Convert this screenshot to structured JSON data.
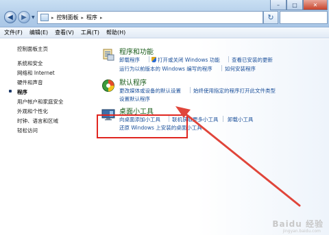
{
  "address": {
    "segments": [
      "控制面板",
      "程序"
    ],
    "separator": "▸"
  },
  "menu": [
    "文件(F)",
    "编辑(E)",
    "查看(V)",
    "工具(T)",
    "帮助(H)"
  ],
  "sidebar": {
    "items": [
      {
        "label": "控制面板主页",
        "active": false
      },
      {
        "label": "系统和安全",
        "active": false
      },
      {
        "label": "网络和 Internet",
        "active": false
      },
      {
        "label": "硬件和声音",
        "active": false
      },
      {
        "label": "程序",
        "active": true
      },
      {
        "label": "用户帐户和家庭安全",
        "active": false
      },
      {
        "label": "外观和个性化",
        "active": false
      },
      {
        "label": "时钟、语言和区域",
        "active": false
      },
      {
        "label": "轻松访问",
        "active": false
      }
    ]
  },
  "categories": {
    "programs": {
      "title": "程序和功能",
      "links": [
        "卸载程序",
        "打开或关闭 Windows 功能",
        "查看已安装的更新",
        "运行为以前版本的 Windows 编写的程序",
        "如何安装程序"
      ]
    },
    "defaults": {
      "title": "默认程序",
      "links": [
        "更改媒体或设备的默认设置",
        "始终使用指定的程序打开此文件类型",
        "设置默认程序"
      ]
    },
    "gadgets": {
      "title": "桌面小工具",
      "links": [
        "向桌面添加小工具",
        "联机获取更多小工具",
        "卸载小工具",
        "还原 Windows 上安装的桌面小工具"
      ]
    }
  },
  "watermark": {
    "brand": "Baidu 经验",
    "url": "jingyan.baidu.com"
  },
  "colors": {
    "highlight": "#e0251f",
    "link": "#1a4f9a",
    "title": "#1a5c1a"
  }
}
